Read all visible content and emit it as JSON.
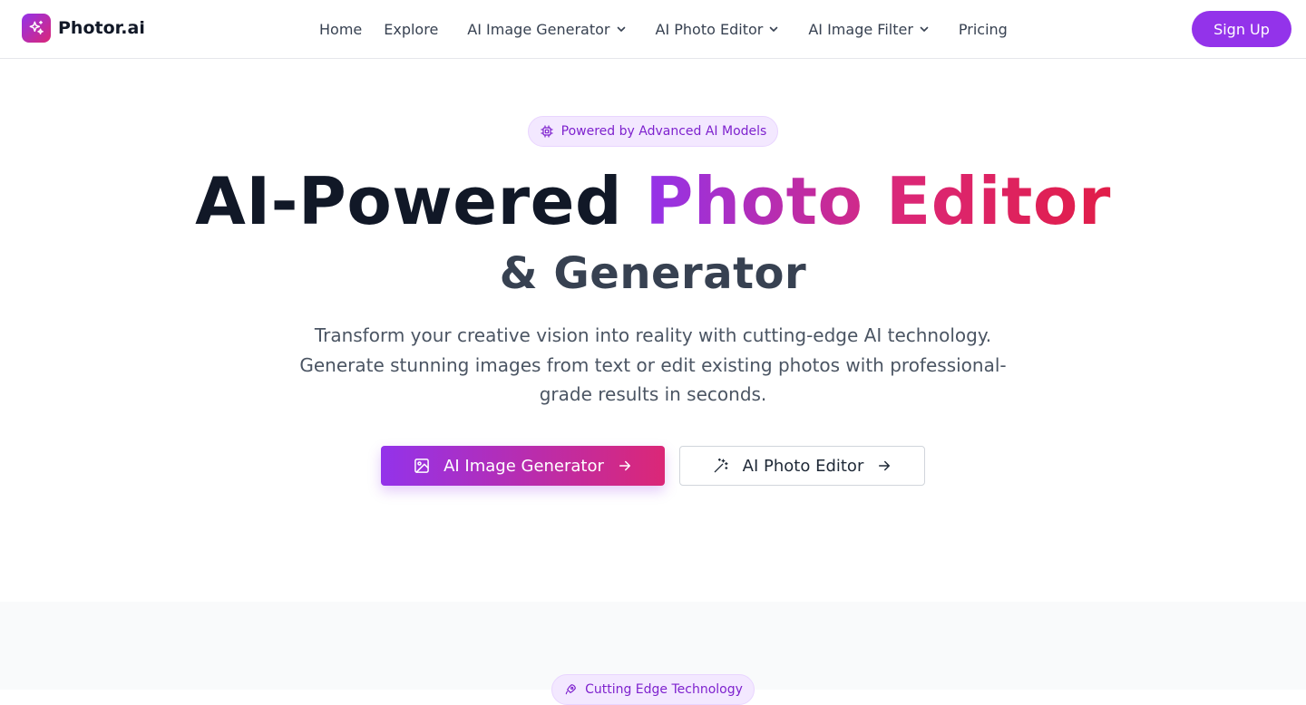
{
  "brand": {
    "name": "Photor.ai",
    "logo_icon": "sparkles-icon",
    "gradient_start": "#9333ea",
    "gradient_end": "#db2777"
  },
  "nav": {
    "items": [
      {
        "label": "Home",
        "has_dropdown": false
      },
      {
        "label": "Explore",
        "has_dropdown": false
      },
      {
        "label": "AI Image Generator",
        "has_dropdown": true
      },
      {
        "label": "AI Photo Editor",
        "has_dropdown": true
      },
      {
        "label": "AI Image Filter",
        "has_dropdown": true
      },
      {
        "label": "Pricing",
        "has_dropdown": false
      }
    ],
    "signup_label": "Sign Up"
  },
  "hero": {
    "badge": {
      "icon": "cpu-chip-icon",
      "text": "Powered by Advanced AI Models"
    },
    "title_part1": "AI-Powered",
    "title_part2": "Photo Editor",
    "title_line2": "& Generator",
    "subtitle": "Transform your creative vision into reality with cutting-edge AI technology. Generate stunning images from text or edit existing photos with professional-grade results in seconds.",
    "primary_button": {
      "label": "AI Image Generator",
      "icon": "image-icon"
    },
    "secondary_button": {
      "label": "AI Photo Editor",
      "icon": "magic-wand-icon"
    }
  },
  "next_section": {
    "badge": {
      "icon": "rocket-icon",
      "text": "Cutting Edge Technology"
    }
  },
  "colors": {
    "accent": "#9333ea",
    "title_dark": "#111827",
    "subtitle_gray": "#4b5563",
    "badge_bg": "#f3e8ff",
    "badge_text": "#7e22ce",
    "section_bg": "#f9fafb"
  }
}
